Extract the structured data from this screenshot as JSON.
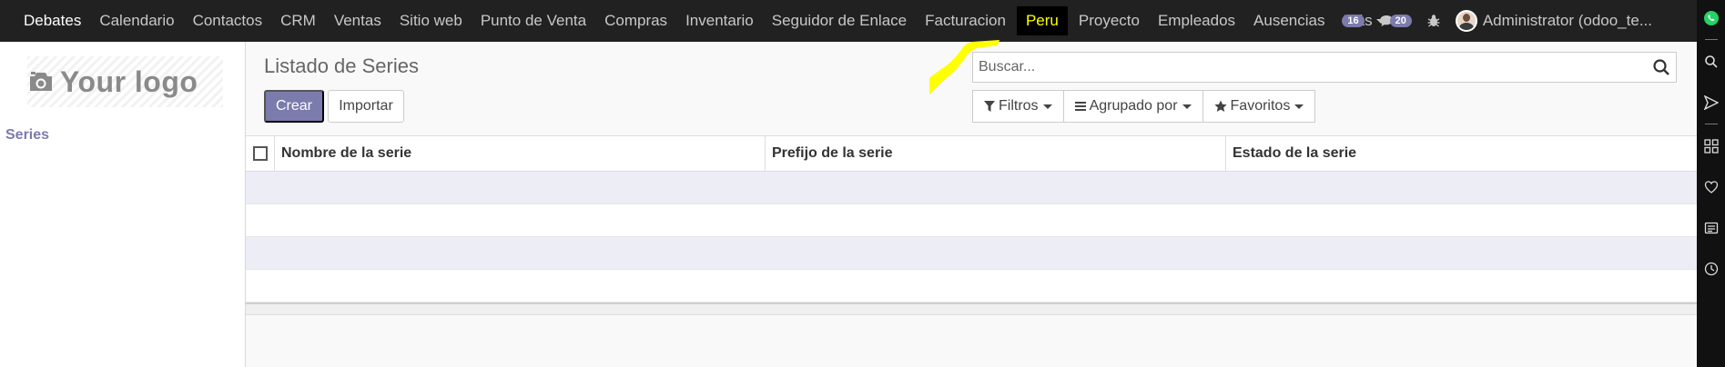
{
  "nav": {
    "items": [
      {
        "label": "Debates"
      },
      {
        "label": "Calendario"
      },
      {
        "label": "Contactos"
      },
      {
        "label": "CRM"
      },
      {
        "label": "Ventas"
      },
      {
        "label": "Sitio web"
      },
      {
        "label": "Punto de Venta"
      },
      {
        "label": "Compras"
      },
      {
        "label": "Inventario"
      },
      {
        "label": "Seguidor de Enlace"
      },
      {
        "label": "Facturacion"
      },
      {
        "label": "Peru"
      },
      {
        "label": "Proyecto"
      },
      {
        "label": "Empleados"
      },
      {
        "label": "Ausencias"
      },
      {
        "label": "Más"
      }
    ],
    "activities_count": "16",
    "messages_count": "20",
    "user": "Administrator (odoo_te..."
  },
  "sidebar": {
    "logo_text": "Your logo",
    "items": [
      {
        "label": "Series"
      }
    ]
  },
  "control": {
    "title": "Listado de Series",
    "create_label": "Crear",
    "import_label": "Importar",
    "search_placeholder": "Buscar...",
    "filters_label": "Filtros",
    "groupby_label": "Agrupado por",
    "favorites_label": "Favoritos"
  },
  "table": {
    "columns": [
      {
        "label": "Nombre de la serie"
      },
      {
        "label": "Prefijo de la serie"
      },
      {
        "label": "Estado de la serie"
      }
    ]
  },
  "colors": {
    "accent": "#7c7bad",
    "topbar": "#212121",
    "highlight": "#ffff00"
  }
}
